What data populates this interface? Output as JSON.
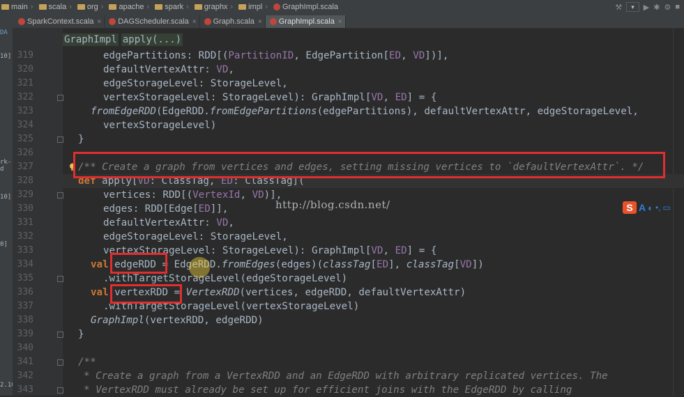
{
  "breadcrumb": [
    "main",
    "scala",
    "org",
    "apache",
    "spark",
    "graphx",
    "impl",
    "GraphImpl.scala"
  ],
  "tabs": [
    {
      "label": "SparkContext.scala",
      "active": false
    },
    {
      "label": "DAGScheduler.scala",
      "active": false
    },
    {
      "label": "Graph.scala",
      "active": false
    },
    {
      "label": "GraphImpl.scala",
      "active": true
    }
  ],
  "context": {
    "class_name": "GraphImpl",
    "method": "apply(...)"
  },
  "left_strip": [
    "DA",
    "10]",
    "rk-d",
    "10]",
    "0]",
    "2.10"
  ],
  "line_numbers": [
    "319",
    "320",
    "321",
    "322",
    "323",
    "324",
    "325",
    "326",
    "327",
    "328",
    "329",
    "330",
    "331",
    "332",
    "333",
    "334",
    "335",
    "336",
    "337",
    "338",
    "339",
    "340",
    "341",
    "342",
    "343"
  ],
  "watermark": "http://blog.csdn.net/",
  "ime_toolbar": {
    "logo": "S",
    "mode": "A"
  },
  "colors": {
    "highlight_box": "#e12e2e",
    "editor_bg": "#2b2b2b",
    "keyword": "#cc7832",
    "type_param": "#9876aa",
    "comment": "#808080"
  }
}
